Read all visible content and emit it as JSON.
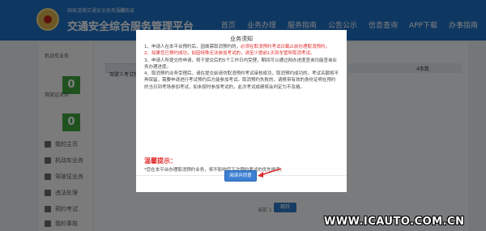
{
  "header": {
    "site_subtitle": "国家道路交通安全政务服务",
    "site_city": "湖南省",
    "site_name": "交通安全综合服务管理平台",
    "nav": [
      "首页",
      "业务办理",
      "服务指南",
      "公告公示",
      "信息查询",
      "APP下载",
      "办事指南"
    ]
  },
  "sidebar": {
    "stats": [
      {
        "label": "机动车业务",
        "value": "0"
      },
      {
        "label": "驾驶证业务",
        "value": "0"
      }
    ],
    "items": [
      "我的主页",
      "机动车业务",
      "驾驶证业务",
      "违法处理",
      "预约考试",
      "我的事故"
    ]
  },
  "main": {
    "tab_label": "驾驶人考试预约",
    "right_value": "4条数",
    "pager_text": "当前 1 页",
    "pager_button": "跳转"
  },
  "dialog": {
    "title": "业务须知",
    "paragraphs": [
      {
        "parts": [
          {
            "text": "1、申请人在本平台预约后，因故需取消预约的，",
            "red": false
          },
          {
            "text": "必须在取消预约考试日截止前办理取消预约。",
            "red": true
          }
        ]
      },
      {
        "parts": [
          {
            "text": "2、如果您已预约成功，如因特殊无法参加考试的，请至少提前1天到车管所取消考试。",
            "red": true
          }
        ]
      },
      {
        "parts": [
          {
            "text": "3、申请人所提交的申请，将于提交后的5个工作日内受理，期间可以通过网办进度查询功能查询业务办理进度。",
            "red": false
          }
        ]
      },
      {
        "parts": [
          {
            "text": "4、取消预约业务受理后，请在提交前请勿取消预约考试审核成功，取消预约成功的，考试名额将不再保留，需要申请进行考试预约后方能参加考试。取消预约失败的，请携带有效的身份证明在预约的当日到考场参加考试，如未按时参加考试的，此次考试成绩将会判定为不及格。",
            "red": false
          }
        ]
      }
    ],
    "tip_title": "温馨提示：",
    "tip_text": "*您在本平台办理取消预约业务，将不影响您下次预约考试的优先排序。",
    "confirm_button": "阅读并同意"
  },
  "watermark": "WWW.ICAUTO.COM.CN",
  "colors": {
    "header_blue": "#1d6fc3",
    "alert_red": "#e02b2b",
    "button_blue": "#3b7fd2",
    "stat_green": "#3fa33f"
  }
}
